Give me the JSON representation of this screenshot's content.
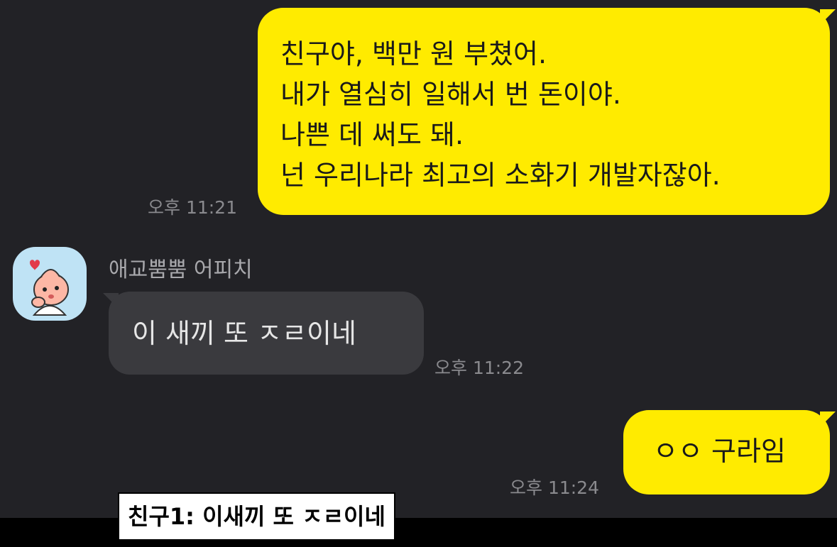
{
  "messages": {
    "m1": {
      "lines": [
        "친구야, 백만 원 부쳤어.",
        "내가 열심히 일해서 번 돈이야.",
        "나쁜 데 써도 돼.",
        "넌 우리나라 최고의 소화기 개발자잖아."
      ],
      "time": "오후 11:21"
    },
    "m2": {
      "sender": "애교뿜뿜 어피치",
      "text": "이 새끼 또 ㅈㄹ이네",
      "time": "오후 11:22"
    },
    "m3": {
      "text": "ㅇㅇ 구라임",
      "time": "오후 11:24"
    }
  },
  "caption": "친구1: 이새끼 또 ㅈㄹ이네",
  "icons": {
    "avatar": "apeach-character-avatar",
    "heart": "heart-icon"
  },
  "colors": {
    "chat_background": "#222226",
    "outgoing_bubble": "#ffeb00",
    "incoming_bubble": "#3a3a3e",
    "timestamp": "#8a8a8e"
  }
}
